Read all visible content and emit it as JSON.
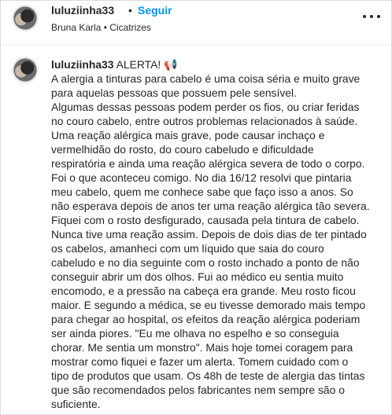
{
  "header": {
    "username": "luluziinha33",
    "dot": "•",
    "follow_label": "Seguir",
    "subline": "Bruna Karla • Cicatrizes",
    "more_icon": "more-horizontal-icon"
  },
  "comment": {
    "username": "luluziinha33",
    "text": " ALERTA! 📢\nA alergia a tinturas para cabelo é uma coisa séria e muito grave\npara aquelas pessoas que possuem pele sensível.\nAlgumas dessas pessoas podem perder os fios, ou criar feridas\nno couro cabelo, entre outros problemas relacionados à saúde.\nUma reação alérgica mais grave, pode causar inchaço e\nvermelhidão do rosto, do couro cabeludo e dificuldade\nrespiratória e ainda uma reação alérgica severa de todo o corpo.\nFoi o que aconteceu comigo. No dia 16/12 resolvi que pintaria\nmeu cabelo, quem me conhece sabe que faço isso a anos. So\nnão esperava depois de anos ter uma reação alérgica tão severa.\nFiquei com o rosto desfigurado, causada pela tintura de cabelo.\nNunca tive uma reação assim. Depois de dois dias de ter pintado\nos cabelos, amanheci com um líquido que saia do couro\ncabeludo e no dia seguinte com o rosto inchado a ponto de não\nconseguir abrir um dos olhos. Fui ao médico eu sentia muito\nencomodo, e a pressão na cabeça era grande. Meu rosto ficou\nmaior. E segundo a médica, se eu tivesse demorado mais tempo\npara chegar ao hospital, os efeitos da reação alérgica poderiam\nser ainda piores. \"Eu me olhava no espelho e so conseguia\nchorar. Me sentia um monstro\". Mais hoje tomei coragem para\nmostrar como fiquei e fazer um alerta. Tomem cuidado com o\ntipo de produtos que usam. Os 48h de teste de alergia das tintas\nque são recomendados pelos fabricantes nem sempre são o\nsuficiente."
  },
  "colors": {
    "follow": "#0095f6",
    "text": "#262626",
    "border": "#dbdbdb"
  }
}
